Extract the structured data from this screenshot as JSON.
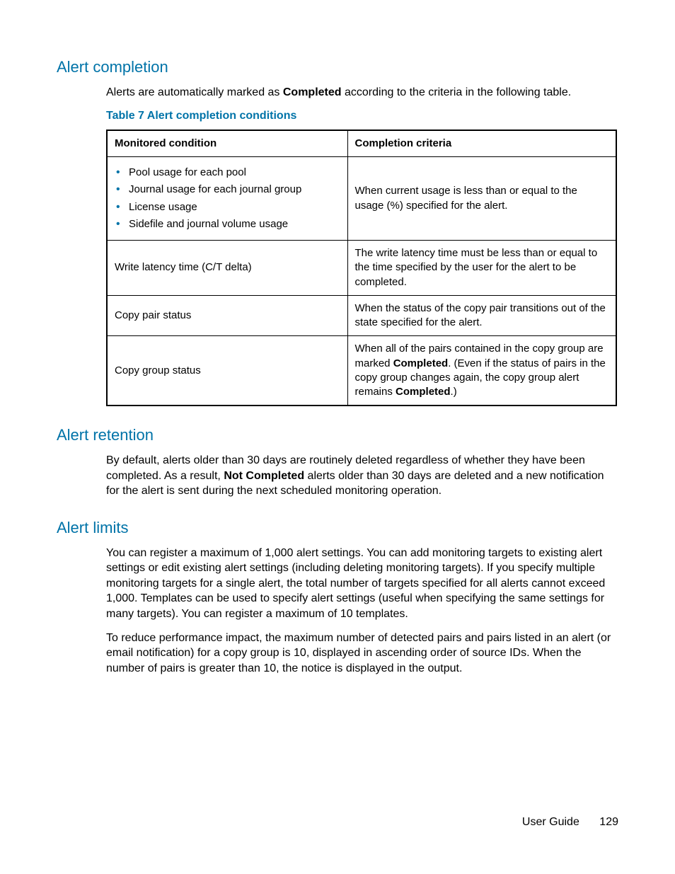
{
  "sections": {
    "alert_completion": {
      "heading": "Alert completion",
      "intro_pre": "Alerts are automatically marked as ",
      "intro_bold": "Completed",
      "intro_post": " according to the criteria in the following table."
    },
    "alert_retention": {
      "heading": "Alert retention",
      "body_pre": "By default, alerts older than 30 days are routinely deleted regardless of whether they have been completed. As a result, ",
      "body_bold": "Not Completed",
      "body_post": " alerts older than 30 days are deleted and a new notification for the alert is sent during the next scheduled monitoring operation."
    },
    "alert_limits": {
      "heading": "Alert limits",
      "p1": "You can register a maximum of 1,000 alert settings. You can add monitoring targets to existing alert settings or edit existing alert settings (including deleting monitoring targets). If you specify multiple monitoring targets for a single alert, the total number of targets specified for all alerts cannot exceed 1,000. Templates can be used to specify alert settings (useful when specifying the same settings for many targets). You can register a maximum of 10 templates.",
      "p2_pre": "To reduce performance impact, the maximum number of detected pairs and pairs listed in an alert (or email notification) for a copy group is 10, displayed in ascending order of source IDs. When the number of pairs is greater than 10, the notice ",
      "p2_post": " is displayed in the output."
    }
  },
  "table": {
    "caption": "Table 7 Alert completion conditions",
    "headers": {
      "col1": "Monitored condition",
      "col2": "Completion criteria"
    },
    "rows": [
      {
        "condition_list": [
          "Pool usage for each pool",
          "Journal usage for each journal group",
          "License usage",
          "Sidefile and journal volume usage"
        ],
        "criteria": "When current usage is less than or equal to the usage (%) specified for the alert."
      },
      {
        "condition_text": "Write latency time (C/T delta)",
        "criteria": "The write latency time must be less than or equal to the time specified by the user for the alert to be completed."
      },
      {
        "condition_text": "Copy pair status",
        "criteria": "When the status of the copy pair transitions out of the state specified for the alert."
      },
      {
        "condition_text": "Copy group status",
        "criteria_pre": "When all of the pairs contained in the copy group are marked ",
        "criteria_b1": "Completed",
        "criteria_mid": ". (Even if the status of pairs in the copy group changes again, the copy group alert remains ",
        "criteria_b2": "Completed",
        "criteria_post": ".)"
      }
    ]
  },
  "footer": {
    "label": "User Guide",
    "page": "129"
  }
}
